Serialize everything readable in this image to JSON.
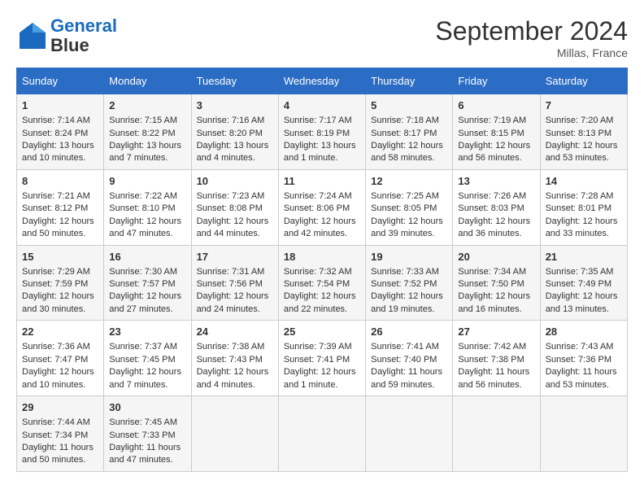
{
  "header": {
    "logo_line1": "General",
    "logo_line2": "Blue",
    "month_title": "September 2024",
    "location": "Millas, France"
  },
  "days_of_week": [
    "Sunday",
    "Monday",
    "Tuesday",
    "Wednesday",
    "Thursday",
    "Friday",
    "Saturday"
  ],
  "weeks": [
    [
      {
        "day": "1",
        "sunrise": "Sunrise: 7:14 AM",
        "sunset": "Sunset: 8:24 PM",
        "daylight": "Daylight: 13 hours and 10 minutes."
      },
      {
        "day": "2",
        "sunrise": "Sunrise: 7:15 AM",
        "sunset": "Sunset: 8:22 PM",
        "daylight": "Daylight: 13 hours and 7 minutes."
      },
      {
        "day": "3",
        "sunrise": "Sunrise: 7:16 AM",
        "sunset": "Sunset: 8:20 PM",
        "daylight": "Daylight: 13 hours and 4 minutes."
      },
      {
        "day": "4",
        "sunrise": "Sunrise: 7:17 AM",
        "sunset": "Sunset: 8:19 PM",
        "daylight": "Daylight: 13 hours and 1 minute."
      },
      {
        "day": "5",
        "sunrise": "Sunrise: 7:18 AM",
        "sunset": "Sunset: 8:17 PM",
        "daylight": "Daylight: 12 hours and 58 minutes."
      },
      {
        "day": "6",
        "sunrise": "Sunrise: 7:19 AM",
        "sunset": "Sunset: 8:15 PM",
        "daylight": "Daylight: 12 hours and 56 minutes."
      },
      {
        "day": "7",
        "sunrise": "Sunrise: 7:20 AM",
        "sunset": "Sunset: 8:13 PM",
        "daylight": "Daylight: 12 hours and 53 minutes."
      }
    ],
    [
      {
        "day": "8",
        "sunrise": "Sunrise: 7:21 AM",
        "sunset": "Sunset: 8:12 PM",
        "daylight": "Daylight: 12 hours and 50 minutes."
      },
      {
        "day": "9",
        "sunrise": "Sunrise: 7:22 AM",
        "sunset": "Sunset: 8:10 PM",
        "daylight": "Daylight: 12 hours and 47 minutes."
      },
      {
        "day": "10",
        "sunrise": "Sunrise: 7:23 AM",
        "sunset": "Sunset: 8:08 PM",
        "daylight": "Daylight: 12 hours and 44 minutes."
      },
      {
        "day": "11",
        "sunrise": "Sunrise: 7:24 AM",
        "sunset": "Sunset: 8:06 PM",
        "daylight": "Daylight: 12 hours and 42 minutes."
      },
      {
        "day": "12",
        "sunrise": "Sunrise: 7:25 AM",
        "sunset": "Sunset: 8:05 PM",
        "daylight": "Daylight: 12 hours and 39 minutes."
      },
      {
        "day": "13",
        "sunrise": "Sunrise: 7:26 AM",
        "sunset": "Sunset: 8:03 PM",
        "daylight": "Daylight: 12 hours and 36 minutes."
      },
      {
        "day": "14",
        "sunrise": "Sunrise: 7:28 AM",
        "sunset": "Sunset: 8:01 PM",
        "daylight": "Daylight: 12 hours and 33 minutes."
      }
    ],
    [
      {
        "day": "15",
        "sunrise": "Sunrise: 7:29 AM",
        "sunset": "Sunset: 7:59 PM",
        "daylight": "Daylight: 12 hours and 30 minutes."
      },
      {
        "day": "16",
        "sunrise": "Sunrise: 7:30 AM",
        "sunset": "Sunset: 7:57 PM",
        "daylight": "Daylight: 12 hours and 27 minutes."
      },
      {
        "day": "17",
        "sunrise": "Sunrise: 7:31 AM",
        "sunset": "Sunset: 7:56 PM",
        "daylight": "Daylight: 12 hours and 24 minutes."
      },
      {
        "day": "18",
        "sunrise": "Sunrise: 7:32 AM",
        "sunset": "Sunset: 7:54 PM",
        "daylight": "Daylight: 12 hours and 22 minutes."
      },
      {
        "day": "19",
        "sunrise": "Sunrise: 7:33 AM",
        "sunset": "Sunset: 7:52 PM",
        "daylight": "Daylight: 12 hours and 19 minutes."
      },
      {
        "day": "20",
        "sunrise": "Sunrise: 7:34 AM",
        "sunset": "Sunset: 7:50 PM",
        "daylight": "Daylight: 12 hours and 16 minutes."
      },
      {
        "day": "21",
        "sunrise": "Sunrise: 7:35 AM",
        "sunset": "Sunset: 7:49 PM",
        "daylight": "Daylight: 12 hours and 13 minutes."
      }
    ],
    [
      {
        "day": "22",
        "sunrise": "Sunrise: 7:36 AM",
        "sunset": "Sunset: 7:47 PM",
        "daylight": "Daylight: 12 hours and 10 minutes."
      },
      {
        "day": "23",
        "sunrise": "Sunrise: 7:37 AM",
        "sunset": "Sunset: 7:45 PM",
        "daylight": "Daylight: 12 hours and 7 minutes."
      },
      {
        "day": "24",
        "sunrise": "Sunrise: 7:38 AM",
        "sunset": "Sunset: 7:43 PM",
        "daylight": "Daylight: 12 hours and 4 minutes."
      },
      {
        "day": "25",
        "sunrise": "Sunrise: 7:39 AM",
        "sunset": "Sunset: 7:41 PM",
        "daylight": "Daylight: 12 hours and 1 minute."
      },
      {
        "day": "26",
        "sunrise": "Sunrise: 7:41 AM",
        "sunset": "Sunset: 7:40 PM",
        "daylight": "Daylight: 11 hours and 59 minutes."
      },
      {
        "day": "27",
        "sunrise": "Sunrise: 7:42 AM",
        "sunset": "Sunset: 7:38 PM",
        "daylight": "Daylight: 11 hours and 56 minutes."
      },
      {
        "day": "28",
        "sunrise": "Sunrise: 7:43 AM",
        "sunset": "Sunset: 7:36 PM",
        "daylight": "Daylight: 11 hours and 53 minutes."
      }
    ],
    [
      {
        "day": "29",
        "sunrise": "Sunrise: 7:44 AM",
        "sunset": "Sunset: 7:34 PM",
        "daylight": "Daylight: 11 hours and 50 minutes."
      },
      {
        "day": "30",
        "sunrise": "Sunrise: 7:45 AM",
        "sunset": "Sunset: 7:33 PM",
        "daylight": "Daylight: 11 hours and 47 minutes."
      },
      null,
      null,
      null,
      null,
      null
    ]
  ]
}
